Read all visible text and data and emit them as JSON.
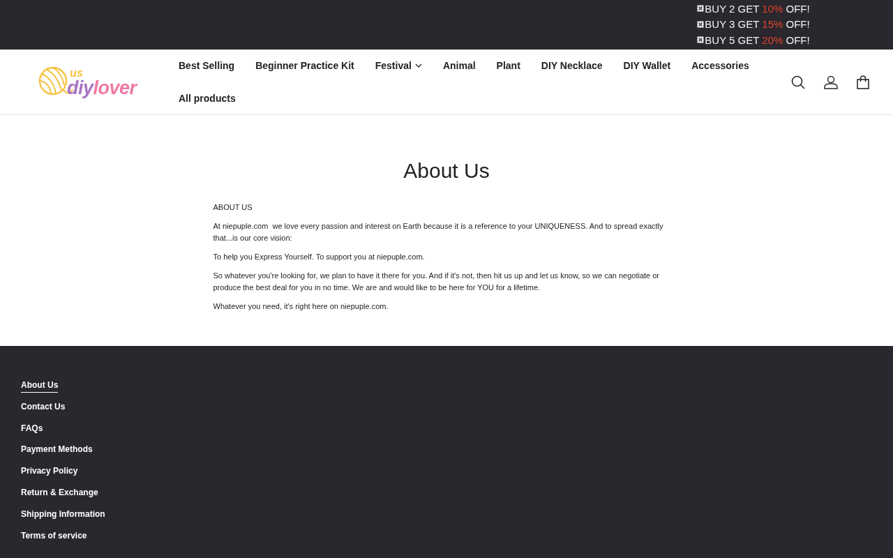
{
  "promo_bar": {
    "lines": [
      {
        "parts": [
          {
            "text": "BUY 2 GET ",
            "highlight": false
          },
          {
            "text": "10%",
            "highlight": true
          },
          {
            "text": " OFF!",
            "highlight": false
          }
        ]
      },
      {
        "parts": [
          {
            "text": "BUY 3 GET ",
            "highlight": false
          },
          {
            "text": "15%",
            "highlight": true
          },
          {
            "text": " OFF!",
            "highlight": false
          }
        ]
      },
      {
        "parts": [
          {
            "text": "BUY 5 GET ",
            "highlight": false
          },
          {
            "text": "20%",
            "highlight": true
          },
          {
            "text": " OFF!",
            "highlight": false
          }
        ]
      }
    ]
  },
  "logo": {
    "top": "us",
    "first": "diy",
    "second": "lover"
  },
  "nav": {
    "items": [
      {
        "label": "Best Selling",
        "dropdown": false
      },
      {
        "label": "Beginner Practice Kit",
        "dropdown": false
      },
      {
        "label": "Festival",
        "dropdown": true
      },
      {
        "label": "Animal",
        "dropdown": false
      },
      {
        "label": "Plant",
        "dropdown": false
      },
      {
        "label": "DIY Necklace",
        "dropdown": false
      },
      {
        "label": "DIY Wallet",
        "dropdown": false
      },
      {
        "label": "Accessories",
        "dropdown": false
      },
      {
        "label": "All products",
        "dropdown": false
      }
    ]
  },
  "page": {
    "title": "About Us",
    "paragraphs": [
      "ABOUT US",
      "At niepuple.com  we love every passion and interest on Earth because it is a reference to your UNIQUENESS. And to spread exactly that...is our core vision:",
      "To help you Express Yourself. To support you at niepuple.com.",
      "So whatever you're looking for, we plan to have it there for you. And if it's not, then hit us up and let us know, so we can negotiate or produce the best deal for you in no time. We are and would like to be here for YOU for a lifetime.",
      "Whatever you need, it's right here on niepuple.com."
    ]
  },
  "footer": {
    "links": [
      {
        "label": "About Us",
        "selected": true
      },
      {
        "label": "Contact Us",
        "selected": false
      },
      {
        "label": "FAQs",
        "selected": false
      },
      {
        "label": "Payment Methods",
        "selected": false
      },
      {
        "label": "Privacy Policy",
        "selected": false
      },
      {
        "label": "Return & Exchange",
        "selected": false
      },
      {
        "label": "Shipping Information",
        "selected": false
      },
      {
        "label": "Terms of service",
        "selected": false
      }
    ]
  }
}
